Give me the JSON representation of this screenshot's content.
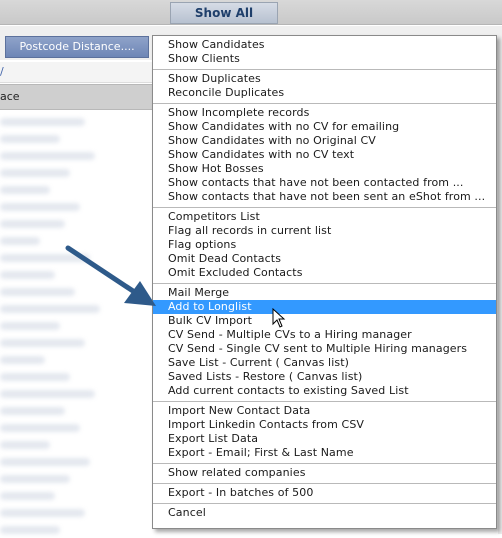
{
  "toolbar": {
    "show_all_label": "Show All",
    "postcode_button_label": "Postcode Distance...."
  },
  "left_panel": {
    "column_header": "ace"
  },
  "menu": {
    "groups": [
      {
        "items": [
          "Show Candidates",
          "Show Clients"
        ]
      },
      {
        "items": [
          "Show Duplicates",
          "Reconcile Duplicates"
        ]
      },
      {
        "items": [
          "Show Incomplete records",
          "Show Candidates with no CV for emailing",
          "Show Candidates with no Original CV",
          "Show Candidates with no CV text",
          "Show Hot Bosses",
          "Show contacts that have not been contacted from ...",
          "Show contacts that have not been sent an eShot from ..."
        ]
      },
      {
        "items": [
          "Competitors List",
          "Flag all records in current list",
          "Flag options",
          "Omit Dead Contacts",
          "Omit Excluded Contacts"
        ]
      },
      {
        "items": [
          "Mail Merge",
          "Add to Longlist",
          "Bulk CV Import",
          "CV Send - Multiple CVs to a Hiring manager",
          "CV Send - Single CV sent to Multiple Hiring managers",
          "Save List - Current ( Canvas list)",
          "Saved Lists - Restore ( Canvas list)",
          "Add current contacts to existing Saved List"
        ]
      },
      {
        "items": [
          "Import New Contact Data",
          "Import Linkedin Contacts from CSV",
          "Export List Data",
          "Export - Email; First & Last Name"
        ]
      },
      {
        "items": [
          "Show related companies"
        ]
      },
      {
        "items": [
          "Export - In batches of 500"
        ]
      },
      {
        "items": [
          "Cancel"
        ]
      }
    ],
    "highlighted_item": "Add to Longlist"
  },
  "colors": {
    "highlight": "#3399ff",
    "annotation_arrow": "#2e5a8a"
  },
  "icons": {
    "cursor": "mouse-pointer-icon",
    "annotation": "arrow-annotation-icon"
  }
}
